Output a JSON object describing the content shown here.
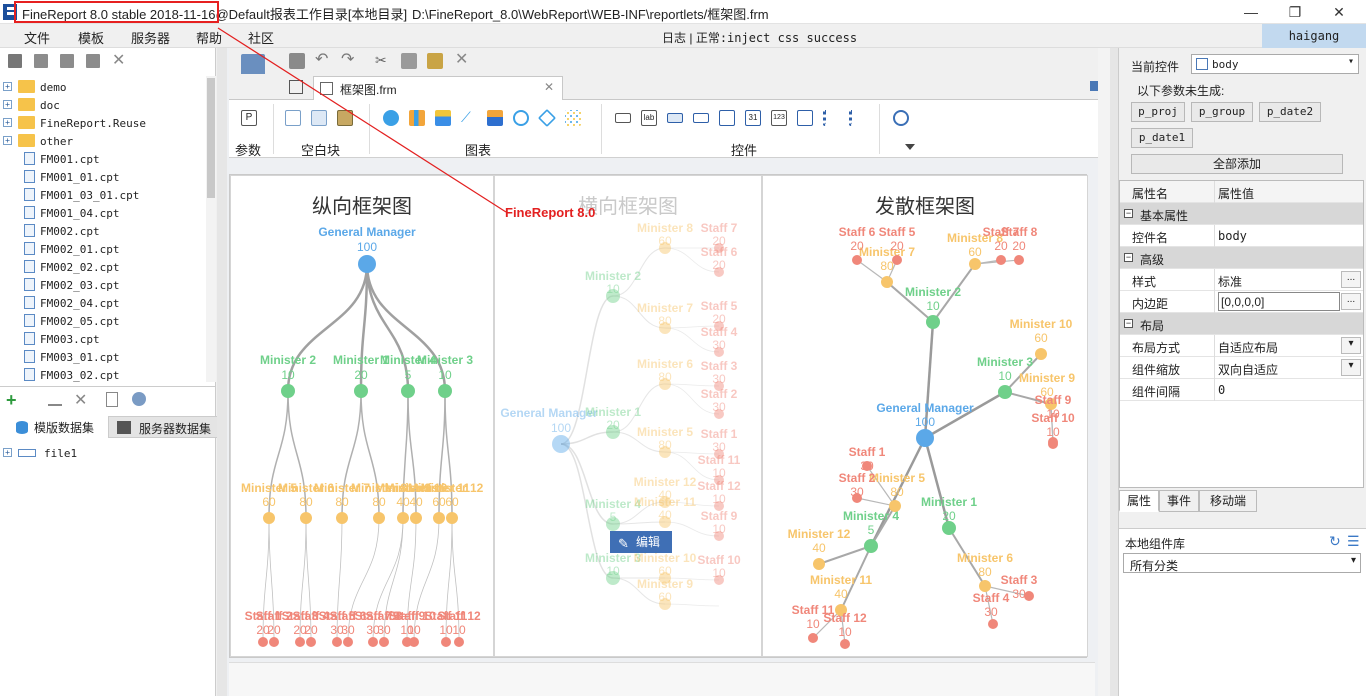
{
  "window": {
    "title_highlight": "FineReport 8.0 stable 2018-11-16",
    "title_rest": "@Default报表工作目录[本地目录]",
    "path": "D:\\FineReport_8.0\\WebReport\\WEB-INF\\reportlets/框架图.frm",
    "controls": [
      "—",
      "❐",
      "✕"
    ]
  },
  "menubar": {
    "items": [
      "文件",
      "模板",
      "服务器",
      "帮助",
      "社区"
    ],
    "log_label": "日志",
    "status": "正常:inject css success",
    "user": "haigang"
  },
  "tree": {
    "items": [
      {
        "label": "demo",
        "type": "folder"
      },
      {
        "label": "doc",
        "type": "folder"
      },
      {
        "label": "FineReport.Reuse",
        "type": "folder"
      },
      {
        "label": "other",
        "type": "folder"
      },
      {
        "label": "FM001.cpt",
        "type": "file"
      },
      {
        "label": "FM001_01.cpt",
        "type": "file"
      },
      {
        "label": "FM001_03_01.cpt",
        "type": "file"
      },
      {
        "label": "FM001_04.cpt",
        "type": "file"
      },
      {
        "label": "FM002.cpt",
        "type": "file"
      },
      {
        "label": "FM002_01.cpt",
        "type": "file"
      },
      {
        "label": "FM002_02.cpt",
        "type": "file"
      },
      {
        "label": "FM002_03.cpt",
        "type": "file"
      },
      {
        "label": "FM002_04.cpt",
        "type": "file"
      },
      {
        "label": "FM002_05.cpt",
        "type": "file"
      },
      {
        "label": "FM003.cpt",
        "type": "file"
      },
      {
        "label": "FM003_01.cpt",
        "type": "file"
      },
      {
        "label": "FM003_02.cpt",
        "type": "file"
      }
    ]
  },
  "datasets": {
    "tab_template": "模版数据集",
    "tab_server": "服务器数据集",
    "item": "file1"
  },
  "editor": {
    "file_tab": "框架图.frm",
    "ribbon": {
      "groups": [
        "参数",
        "空白块",
        "图表",
        "控件"
      ]
    },
    "edit_badge": "编辑"
  },
  "annotation": "FineReport 8.0",
  "charts": {
    "vertical_title": "纵向框架图",
    "horizontal_title": "横向框架图",
    "radial_title": "发散框架图"
  },
  "chart_data": [
    {
      "type": "tree",
      "title": "纵向框架图",
      "root": {
        "name": "General Manager",
        "value": 100
      },
      "level1": [
        {
          "name": "Minister 2",
          "value": 10
        },
        {
          "name": "Minister 1",
          "value": 20
        },
        {
          "name": "Minister 4",
          "value": 5
        },
        {
          "name": "Minister 3",
          "value": 10
        }
      ],
      "level2_values": [
        60,
        80,
        80,
        80,
        40,
        40,
        60,
        60
      ],
      "level3_values": [
        20,
        20,
        20,
        20,
        30,
        30,
        30,
        30,
        10,
        10,
        10,
        10
      ]
    },
    {
      "type": "tree",
      "title": "横向框架图",
      "root": {
        "name": "General Manager",
        "value": 100
      },
      "level1": [
        {
          "name": "Minister 2",
          "value": 10
        },
        {
          "name": "Minister 1",
          "value": 20
        },
        {
          "name": "Minister 4",
          "value": 5
        },
        {
          "name": "Minister 3",
          "value": 10
        }
      ],
      "level2": [
        {
          "name": "Minister 8",
          "value": 60
        },
        {
          "name": "Minister 7",
          "value": 80
        },
        {
          "name": "Minister 6",
          "value": 80
        },
        {
          "name": "Minister 5",
          "value": 80
        },
        {
          "name": "Minister 12",
          "value": 40
        },
        {
          "name": "Minister 11",
          "value": 40
        },
        {
          "name": "Minister 10",
          "value": 60
        },
        {
          "name": "Minister 9",
          "value": 60
        }
      ],
      "level3": [
        {
          "name": "Staff 7",
          "value": 20
        },
        {
          "name": "Staff 6",
          "value": 20
        },
        {
          "name": "Staff 5",
          "value": 20
        },
        {
          "name": "Staff 4",
          "value": 30
        },
        {
          "name": "Staff 3",
          "value": 30
        },
        {
          "name": "Staff 2",
          "value": 30
        },
        {
          "name": "Staff 1",
          "value": 30
        },
        {
          "name": "Staff 11",
          "value": 10
        },
        {
          "name": "Staff 12",
          "value": 10
        },
        {
          "name": "Staff 9",
          "value": 10
        },
        {
          "name": "Staff 10",
          "value": 10
        }
      ]
    },
    {
      "type": "tree",
      "title": "发散框架图",
      "root": {
        "name": "General Manager",
        "value": 100
      },
      "level1": [
        {
          "name": "Minister 2",
          "value": 10
        },
        {
          "name": "Minister 3",
          "value": 10
        },
        {
          "name": "Minister 1",
          "value": 20
        },
        {
          "name": "Minister 4",
          "value": 5
        }
      ],
      "level2": [
        {
          "name": "Minister 7",
          "value": 80
        },
        {
          "name": "Minister 8",
          "value": 60
        },
        {
          "name": "Minister 10",
          "value": 60
        },
        {
          "name": "Minister 9",
          "value": 60
        },
        {
          "name": "Minister 5",
          "value": 80
        },
        {
          "name": "Minister 6",
          "value": 80
        },
        {
          "name": "Minister 12",
          "value": 40
        },
        {
          "name": "Minister 11",
          "value": 40
        }
      ],
      "level3": [
        {
          "name": "Staff 6",
          "value": 20
        },
        {
          "name": "Staff 5",
          "value": 20
        },
        {
          "name": "Staff 7",
          "value": 20
        },
        {
          "name": "Staff 8",
          "value": 20
        },
        {
          "name": "Staff 9",
          "value": 10
        },
        {
          "name": "Staff 10",
          "value": 10
        },
        {
          "name": "Staff 1",
          "value": 30
        },
        {
          "name": "Staff 2",
          "value": 30
        },
        {
          "name": "Staff 3",
          "value": 30
        },
        {
          "name": "Staff 4",
          "value": 30
        },
        {
          "name": "Staff 11",
          "value": 10
        },
        {
          "name": "Staff 12",
          "value": 10
        }
      ]
    }
  ],
  "colors": {
    "root": "#5ba8e8",
    "minister": "#6fd08a",
    "minister2": "#f7c56b",
    "staff": "#f0877a"
  },
  "right": {
    "current_control_label": "当前控件",
    "current_control": "body",
    "params_note": "以下参数未生成:",
    "params": [
      "p_proj",
      "p_group",
      "p_date2",
      "p_date1"
    ],
    "add_all": "全部添加",
    "col_name": "属性名",
    "col_value": "属性值",
    "sections": {
      "basic": "基本属性",
      "advanced": "高级",
      "layout": "布局"
    },
    "props": {
      "name_k": "控件名",
      "name_v": "body",
      "style_k": "样式",
      "style_v": "标准",
      "padding_k": "内边距",
      "padding_v": "[0,0,0,0]",
      "layout_k": "布局方式",
      "layout_v": "自适应布局",
      "scale_k": "组件缩放",
      "scale_v": "双向自适应",
      "gap_k": "组件间隔",
      "gap_v": "0"
    },
    "tabs": [
      "属性",
      "事件",
      "移动端"
    ],
    "lib_label": "本地组件库",
    "lib_filter": "所有分类"
  }
}
